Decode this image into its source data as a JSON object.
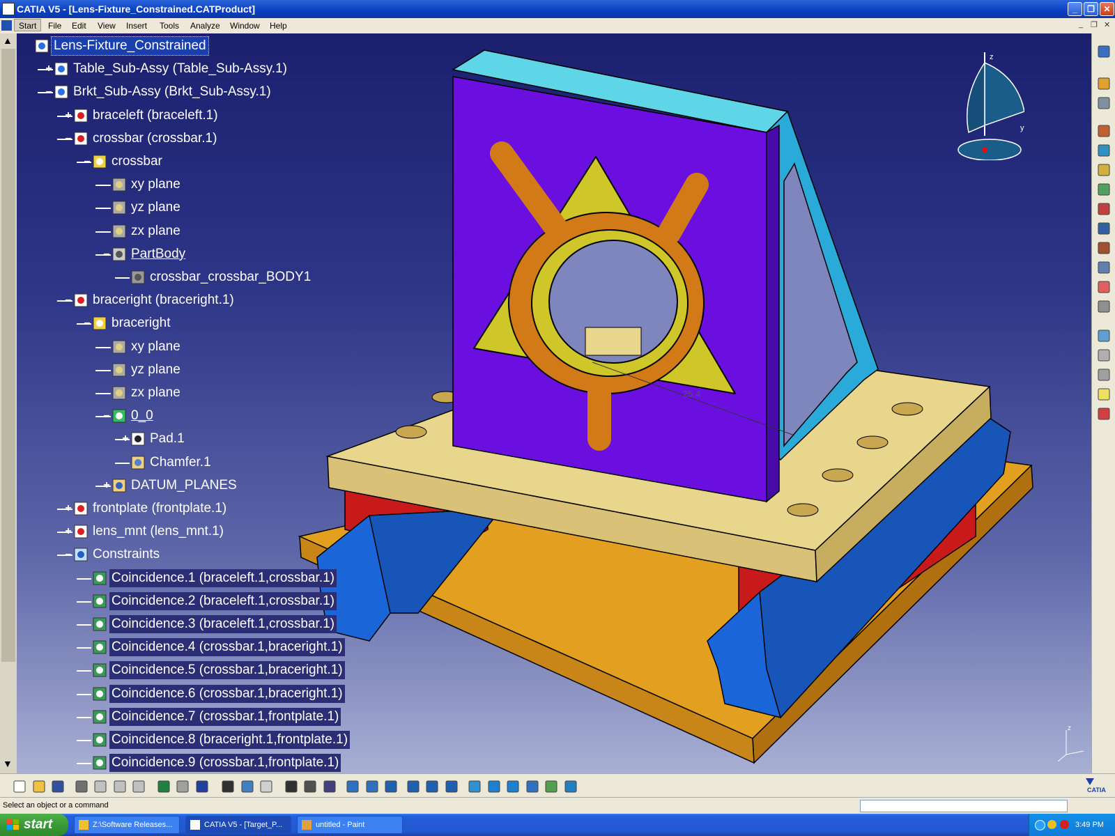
{
  "window": {
    "title": "CATIA V5 - [Lens-Fixture_Constrained.CATProduct]"
  },
  "menubar": {
    "start": "Start",
    "items": [
      "File",
      "Edit",
      "View",
      "Insert",
      "Tools",
      "Analyze",
      "Window",
      "Help"
    ]
  },
  "tree": [
    {
      "label": "Lens-Fixture_Constrained",
      "level": 0,
      "icon": "product-icon",
      "selected": true
    },
    {
      "label": "Table_Sub-Assy (Table_Sub-Assy.1)",
      "level": 1,
      "icon": "product-icon",
      "toggle": "+"
    },
    {
      "label": "Brkt_Sub-Assy (Brkt_Sub-Assy.1)",
      "level": 1,
      "icon": "product-icon",
      "toggle": "-"
    },
    {
      "label": "braceleft (braceleft.1)",
      "level": 2,
      "icon": "part-instance-icon",
      "toggle": "+"
    },
    {
      "label": "crossbar (crossbar.1)",
      "level": 2,
      "icon": "part-instance-icon",
      "toggle": "-"
    },
    {
      "label": "crossbar",
      "level": 3,
      "icon": "part-gear-icon",
      "toggle": "-"
    },
    {
      "label": "xy plane",
      "level": 4,
      "icon": "plane-icon"
    },
    {
      "label": "yz plane",
      "level": 4,
      "icon": "plane-icon"
    },
    {
      "label": "zx plane",
      "level": 4,
      "icon": "plane-icon"
    },
    {
      "label": "PartBody",
      "level": 4,
      "icon": "partbody-gear-icon",
      "toggle": "-",
      "underline": true
    },
    {
      "label": "crossbar_crossbar_BODY1",
      "level": 5,
      "icon": "solid-body-icon"
    },
    {
      "label": "braceright (braceright.1)",
      "level": 2,
      "icon": "part-instance-icon",
      "toggle": "-"
    },
    {
      "label": "braceright",
      "level": 3,
      "icon": "part-gear-icon",
      "toggle": "-"
    },
    {
      "label": "xy plane",
      "level": 4,
      "icon": "plane-icon"
    },
    {
      "label": "yz plane",
      "level": 4,
      "icon": "plane-icon"
    },
    {
      "label": "zx plane",
      "level": 4,
      "icon": "plane-icon"
    },
    {
      "label": "0_0",
      "level": 4,
      "icon": "body-gear-green-icon",
      "toggle": "-",
      "underline": true
    },
    {
      "label": "Pad.1",
      "level": 5,
      "icon": "pad-icon",
      "toggle": "+"
    },
    {
      "label": "Chamfer.1",
      "level": 5,
      "icon": "chamfer-icon"
    },
    {
      "label": "DATUM_PLANES",
      "level": 4,
      "icon": "geometrical-set-icon",
      "toggle": "+"
    },
    {
      "label": "frontplate (frontplate.1)",
      "level": 2,
      "icon": "part-instance-icon",
      "toggle": "+"
    },
    {
      "label": "lens_mnt (lens_mnt.1)",
      "level": 2,
      "icon": "part-instance-icon",
      "toggle": "+"
    },
    {
      "label": "Constraints",
      "level": 2,
      "icon": "constraints-icon",
      "toggle": "-"
    },
    {
      "label": "Coincidence.1 (braceleft.1,crossbar.1)",
      "level": 3,
      "icon": "coincidence-icon",
      "constraint": true
    },
    {
      "label": "Coincidence.2 (braceleft.1,crossbar.1)",
      "level": 3,
      "icon": "coincidence-icon",
      "constraint": true
    },
    {
      "label": "Coincidence.3 (braceleft.1,crossbar.1)",
      "level": 3,
      "icon": "coincidence-icon",
      "constraint": true
    },
    {
      "label": "Coincidence.4 (crossbar.1,braceright.1)",
      "level": 3,
      "icon": "coincidence-icon",
      "constraint": true
    },
    {
      "label": "Coincidence.5 (crossbar.1,braceright.1)",
      "level": 3,
      "icon": "coincidence-icon",
      "constraint": true
    },
    {
      "label": "Coincidence.6 (crossbar.1,braceright.1)",
      "level": 3,
      "icon": "coincidence-icon",
      "constraint": true
    },
    {
      "label": "Coincidence.7 (crossbar.1,frontplate.1)",
      "level": 3,
      "icon": "coincidence-icon",
      "constraint": true
    },
    {
      "label": "Coincidence.8 (braceright.1,frontplate.1)",
      "level": 3,
      "icon": "coincidence-icon",
      "constraint": true
    },
    {
      "label": "Coincidence.9 (crossbar.1,frontplate.1)",
      "level": 3,
      "icon": "coincidence-icon",
      "constraint": true
    }
  ],
  "viewport": {
    "dimension_label": "25.4",
    "compass": {
      "z": "z",
      "y": "y"
    },
    "axis": {
      "z": "z"
    }
  },
  "right_toolbar": {
    "icons": [
      "product-structure-icon",
      "select-arrow-icon",
      "space-analysis-icon",
      "assembly-constraints-icon",
      "insert-component-icon",
      "new-part-icon",
      "existing-component-icon",
      "replace-component-icon",
      "fix-component-icon",
      "reorder-tree-icon",
      "generate-numbering-icon",
      "multi-instantiation-icon",
      "scenes-icon",
      "manipulation-icon",
      "clash-icon",
      "sectioning-icon",
      "lightbulb-icon",
      "update-icon"
    ]
  },
  "bottom_toolbar": {
    "icons": [
      "new-icon",
      "open-icon",
      "save-icon",
      "print-icon",
      "cut-icon",
      "copy-icon",
      "paste-icon",
      "undo-icon",
      "redo-icon",
      "whats-this-icon",
      "formula-icon",
      "knowledge-icon",
      "no-show-icon",
      "table-icon",
      "catalog-icon",
      "measure-icon",
      "fly-mode-icon",
      "fit-all-icon",
      "pan-icon",
      "rotate-icon",
      "zoom-in-icon",
      "zoom-out-icon",
      "normal-view-icon",
      "multi-view-icon",
      "iso-view-icon",
      "render-style-icon",
      "hide-show-icon",
      "swap-visible-icon"
    ]
  },
  "brand": {
    "logo": "CATIA"
  },
  "status": {
    "text": "Select an object or a command"
  },
  "taskbar": {
    "start": "start",
    "tasks": [
      "Z:\\Software Releases...",
      "CATIA V5 - [Target_P...",
      "untitled - Paint"
    ],
    "clock": "3:49 PM"
  },
  "colors": {
    "viewport_top": "#1b1f6e",
    "viewport_bottom": "#a9b0d4",
    "front_plate": "#6a0fe0",
    "table": "#e8d68c",
    "base": "#e3a020",
    "blocks": "#c81a1a",
    "rails": "#1a66d8",
    "lens_mount": "#d27a18",
    "triangle": "#cfc62a",
    "brace": "#2aaad8"
  }
}
